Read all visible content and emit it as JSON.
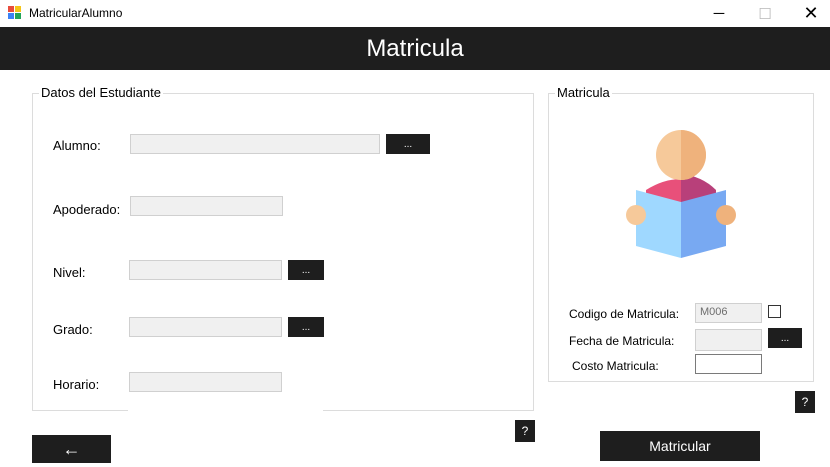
{
  "window": {
    "title": "MatricularAlumno",
    "minimize_glyph": "─",
    "maximize_glyph": "☐",
    "close_glyph": "✕"
  },
  "header": {
    "title": "Matricula"
  },
  "student_group": {
    "legend": "Datos del Estudiante",
    "alumno_label": "Alumno:",
    "alumno_value": "",
    "apoderado_label": "Apoderado:",
    "apoderado_value": "",
    "nivel_label": "Nivel:",
    "nivel_value": "",
    "grado_label": "Grado:",
    "grado_value": "",
    "horario_label": "Horario:",
    "horario_value": "",
    "browse_label": "..."
  },
  "matricula_group": {
    "legend": "Matricula",
    "illustration_icon": "student-reading-icon",
    "codigo_label": "Codigo de Matricula:",
    "codigo_value": "M006",
    "fecha_label": "Fecha de Matricula:",
    "fecha_value": "",
    "costo_label": "Costo Matricula:",
    "costo_value": "",
    "browse_label": "..."
  },
  "help_label": "?",
  "back_label": "←",
  "matricular_label": "Matricular",
  "colors": {
    "dark": "#1e1e1e",
    "field_bg": "#f0f0f0",
    "group_border": "#dcdcdc"
  }
}
